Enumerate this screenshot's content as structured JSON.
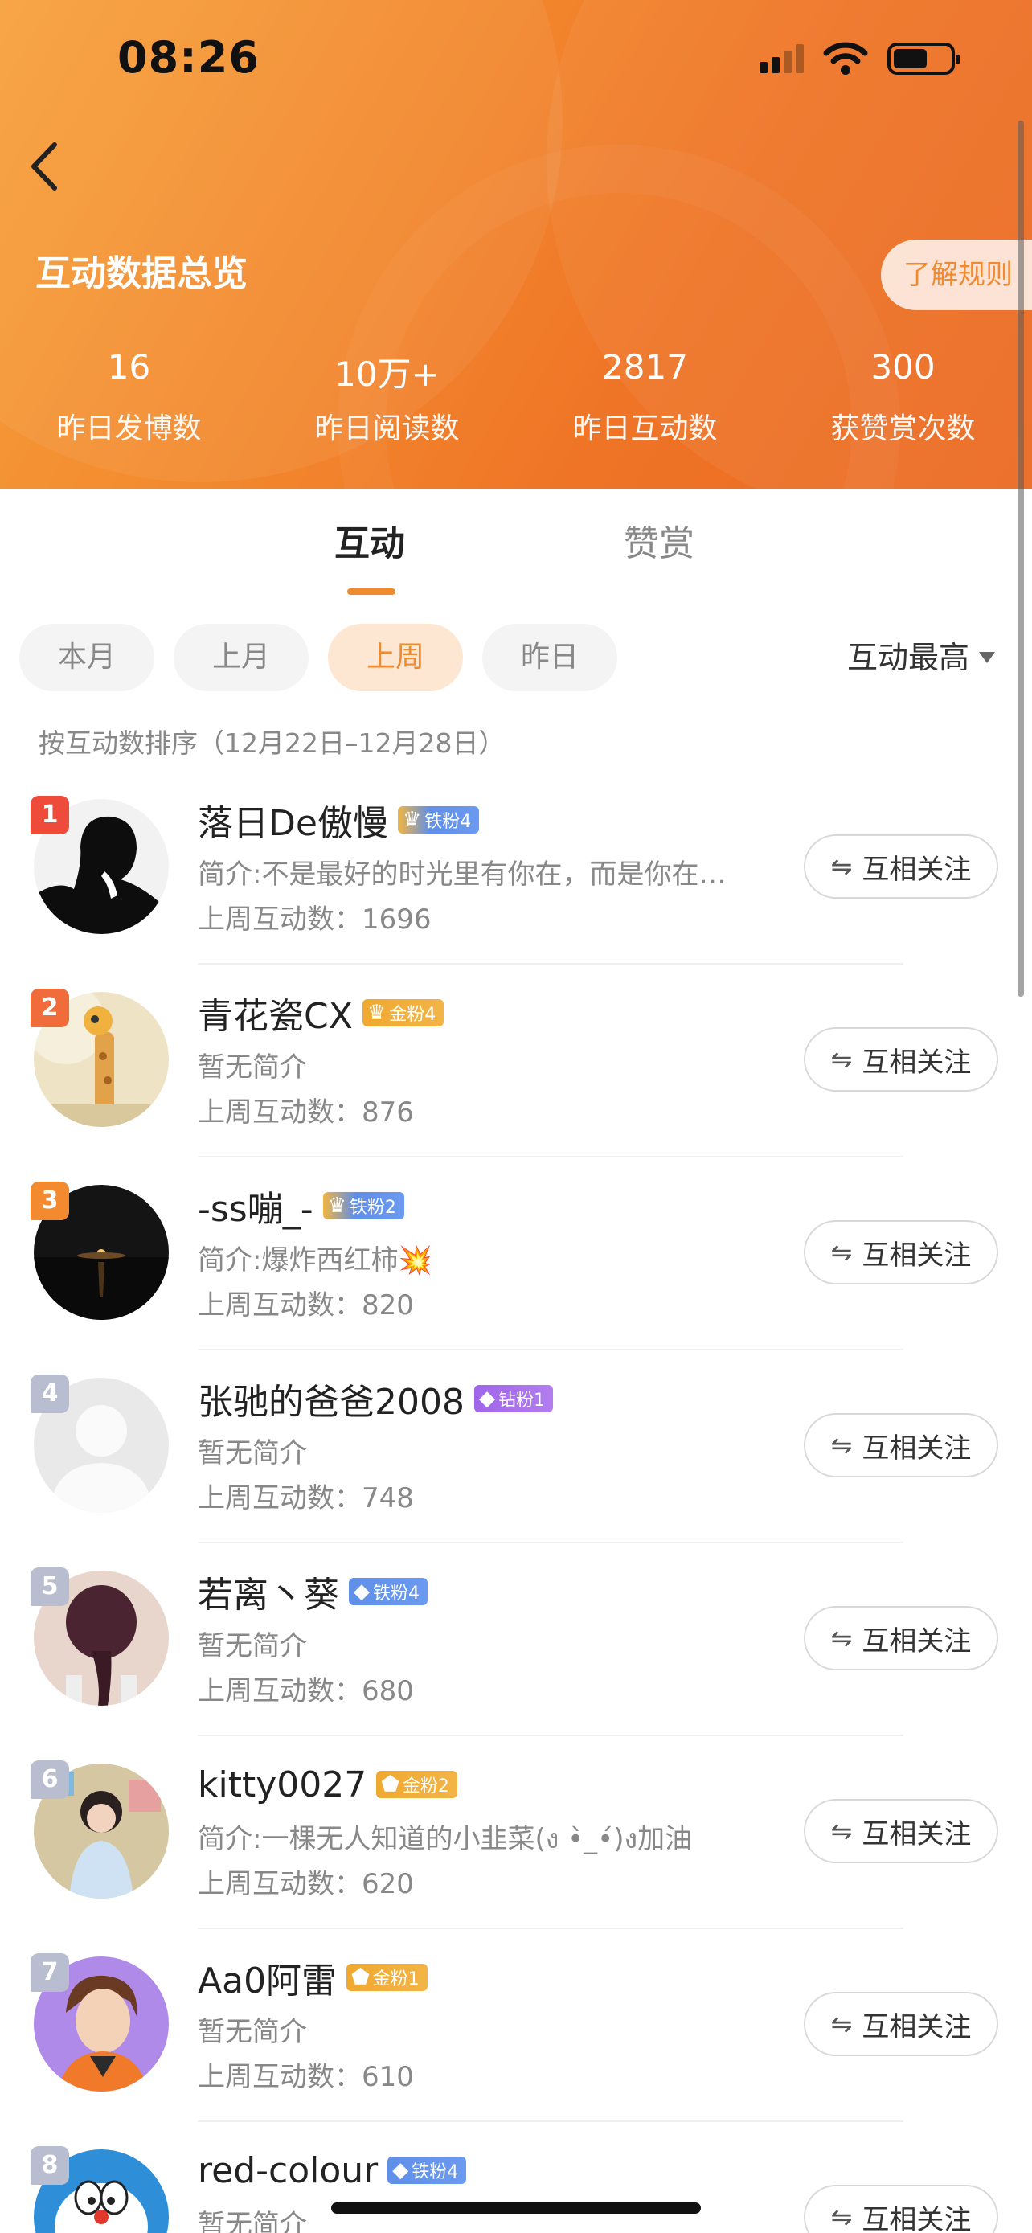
{
  "status_bar": {
    "time": "08:26"
  },
  "header": {
    "title": "互动数据总览",
    "rules_button": "了解规则",
    "stats": [
      {
        "value": "16",
        "label": "昨日发博数"
      },
      {
        "value": "10万+",
        "label": "昨日阅读数"
      },
      {
        "value": "2817",
        "label": "昨日互动数"
      },
      {
        "value": "300",
        "label": "获赞赏次数"
      }
    ]
  },
  "tabs": {
    "active": "互动",
    "inactive": "赞赏"
  },
  "filters": {
    "pills": [
      "本月",
      "上月",
      "上周",
      "昨日"
    ],
    "active_index": 2,
    "sort_label": "互动最高"
  },
  "sort_description": "按互动数排序（12月22日–12月28日）",
  "colors": {
    "accent": "#f08a2f",
    "rank_top1": "#ef4b3b",
    "rank_top2": "#f06c3a",
    "rank_top3": "#f48a30",
    "rank_other": "#b8bed0"
  },
  "list": [
    {
      "rank": "1",
      "name": "落日De傲慢",
      "badge": "铁粉4",
      "badge_type": "iron-crown",
      "bio": "简介:不是最好的时光里有你在，而是你在…",
      "count": "上周互动数：1696",
      "follow": "互相关注"
    },
    {
      "rank": "2",
      "name": "青花瓷CX",
      "badge": "金粉4",
      "badge_type": "gold-crown",
      "bio": "暂无简介",
      "count": "上周互动数：876",
      "follow": "互相关注"
    },
    {
      "rank": "3",
      "name": "-ss嘣_-",
      "badge": "铁粉2",
      "badge_type": "iron-crown",
      "bio": "简介:爆炸西红柿💥",
      "count": "上周互动数：820",
      "follow": "互相关注"
    },
    {
      "rank": "4",
      "name": "张驰的爸爸2008",
      "badge": "钻粉1",
      "badge_type": "diamond",
      "bio": "暂无简介",
      "count": "上周互动数：748",
      "follow": "互相关注"
    },
    {
      "rank": "5",
      "name": "若离丶葵",
      "badge": "铁粉4",
      "badge_type": "iron",
      "bio": "暂无简介",
      "count": "上周互动数：680",
      "follow": "互相关注"
    },
    {
      "rank": "6",
      "name": "kitty0027",
      "badge": "金粉2",
      "badge_type": "gold",
      "bio": "简介:一棵无人知道的小韭菜(ง •̀_•́)ง加油",
      "count": "上周互动数：620",
      "follow": "互相关注"
    },
    {
      "rank": "7",
      "name": "Aa0阿雷",
      "badge": "金粉1",
      "badge_type": "gold",
      "bio": "暂无简介",
      "count": "上周互动数：610",
      "follow": "互相关注"
    },
    {
      "rank": "8",
      "name": "red-colour",
      "badge": "铁粉4",
      "badge_type": "iron",
      "bio": "暂无简介",
      "count": "",
      "follow": "互相关注"
    }
  ]
}
